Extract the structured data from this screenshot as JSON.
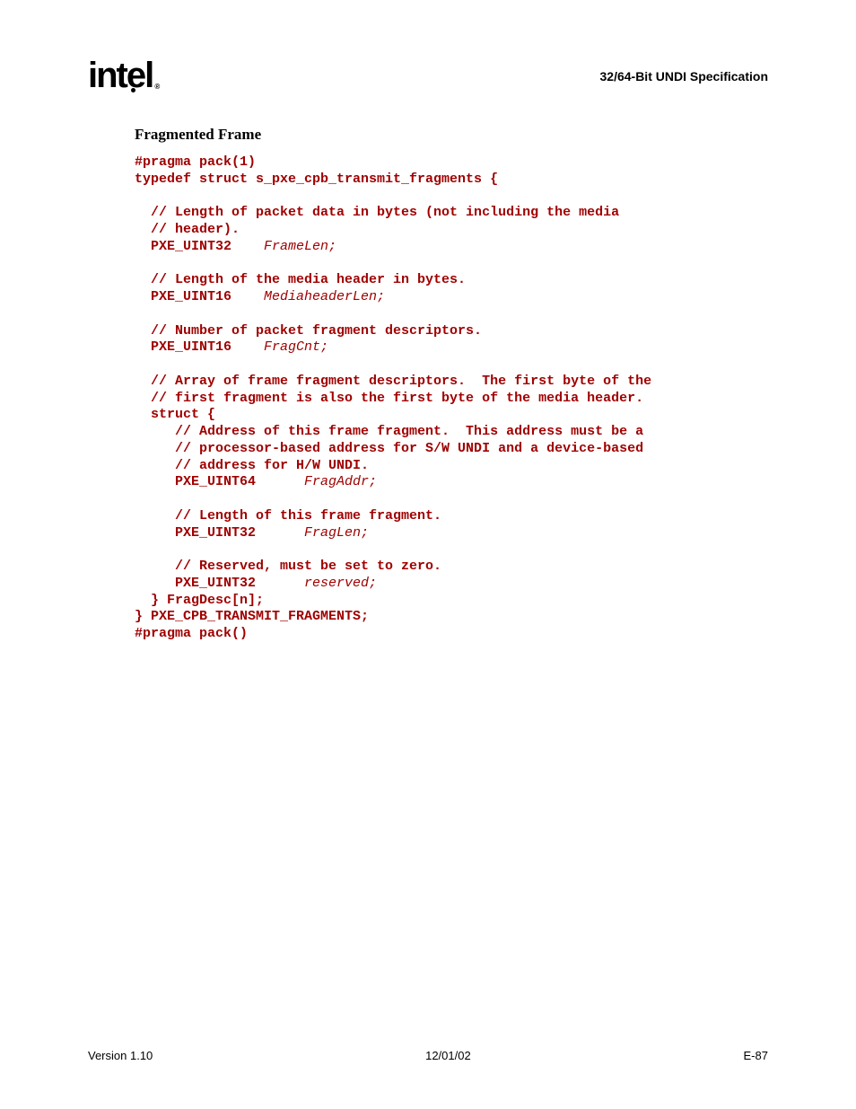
{
  "header": {
    "logo_text": "intel",
    "title": "32/64-Bit UNDI Specification"
  },
  "section": {
    "title": "Fragmented Frame"
  },
  "code": {
    "l01": "#pragma pack(1)",
    "l02": "typedef struct s_pxe_cpb_transmit_fragments {",
    "l03": "",
    "l04": "  // Length of packet data in bytes (not including the media",
    "l05": "  // header).",
    "l06a": "  PXE_UINT32    ",
    "l06b": "FrameLen;",
    "l07": "",
    "l08": "  // Length of the media header in bytes.",
    "l09a": "  PXE_UINT16    ",
    "l09b": "MediaheaderLen;",
    "l10": "",
    "l11": "  // Number of packet fragment descriptors.",
    "l12a": "  PXE_UINT16    ",
    "l12b": "FragCnt;",
    "l13": "",
    "l14": "  // Array of frame fragment descriptors.  The first byte of the",
    "l15": "  // first fragment is also the first byte of the media header.",
    "l16": "  struct {",
    "l17": "     // Address of this frame fragment.  This address must be a",
    "l18": "     // processor-based address for S/W UNDI and a device-based",
    "l19": "     // address for H/W UNDI.",
    "l20a": "     PXE_UINT64      ",
    "l20b": "FragAddr;",
    "l21": "",
    "l22": "     // Length of this frame fragment.",
    "l23a": "     PXE_UINT32      ",
    "l23b": "FragLen;",
    "l24": "",
    "l25": "     // Reserved, must be set to zero.",
    "l26a": "     PXE_UINT32      ",
    "l26b": "reserved;",
    "l27": "  } FragDesc[n];",
    "l28": "} PXE_CPB_TRANSMIT_FRAGMENTS;",
    "l29": "#pragma pack()"
  },
  "footer": {
    "version": "Version 1.10",
    "date": "12/01/02",
    "page": "E-87"
  }
}
